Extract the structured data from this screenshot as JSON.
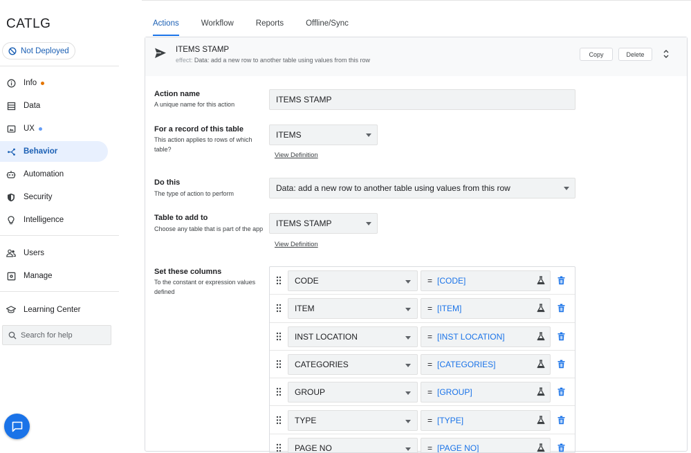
{
  "app": {
    "brand": "CATLG",
    "deploy_status": "Not Deployed"
  },
  "sidebar": {
    "items": [
      {
        "label": "Info",
        "icon": "info-icon",
        "dot": "#e37400"
      },
      {
        "label": "Data",
        "icon": "data-icon"
      },
      {
        "label": "UX",
        "icon": "ux-icon",
        "dot": "#669df6"
      },
      {
        "label": "Behavior",
        "icon": "behavior-icon",
        "active": true
      },
      {
        "label": "Automation",
        "icon": "automation-icon"
      },
      {
        "label": "Security",
        "icon": "shield-icon"
      },
      {
        "label": "Intelligence",
        "icon": "lightbulb-icon"
      },
      {
        "label": "Users",
        "icon": "users-icon"
      },
      {
        "label": "Manage",
        "icon": "manage-icon"
      },
      {
        "label": "Learning Center",
        "icon": "graduation-cap-icon"
      }
    ],
    "search_placeholder": "Search for help"
  },
  "tabs": [
    {
      "label": "Actions",
      "active": true
    },
    {
      "label": "Workflow"
    },
    {
      "label": "Reports"
    },
    {
      "label": "Offline/Sync"
    }
  ],
  "action": {
    "title": "ITEMS STAMP",
    "effect_label": "effect:",
    "effect_value": "Data: add a new row to another table using values from this row",
    "copy_label": "Copy",
    "delete_label": "Delete"
  },
  "form": {
    "action_name": {
      "label": "Action name",
      "desc": "A unique name for this action",
      "value": "ITEMS STAMP"
    },
    "table": {
      "label": "For a record of this table",
      "desc": "This action applies to rows of which table?",
      "value": "ITEMS",
      "link": "View Definition"
    },
    "do_this": {
      "label": "Do this",
      "desc": "The type of action to perform",
      "value": "Data: add a new row to another table using values from this row"
    },
    "table_to_add": {
      "label": "Table to add to",
      "desc": "Choose any table that is part of the app",
      "value": "ITEMS STAMP",
      "link": "View Definition"
    },
    "set_columns": {
      "label": "Set these columns",
      "desc": "To the constant or expression values defined",
      "rows": [
        {
          "column": "CODE",
          "expr": "[CODE]"
        },
        {
          "column": "ITEM",
          "expr": "[ITEM]"
        },
        {
          "column": "INST LOCATION",
          "expr": "[INST LOCATION]"
        },
        {
          "column": "CATEGORIES",
          "expr": "[CATEGORIES]"
        },
        {
          "column": "GROUP",
          "expr": "[GROUP]"
        },
        {
          "column": "TYPE",
          "expr": "[TYPE]"
        },
        {
          "column": "PAGE NO",
          "expr": "[PAGE NO]"
        }
      ],
      "equals": "="
    }
  },
  "colors": {
    "accent": "#1a73e8",
    "active_nav_bg": "#e8f0fe",
    "delete_icon": "#1a73e8"
  }
}
